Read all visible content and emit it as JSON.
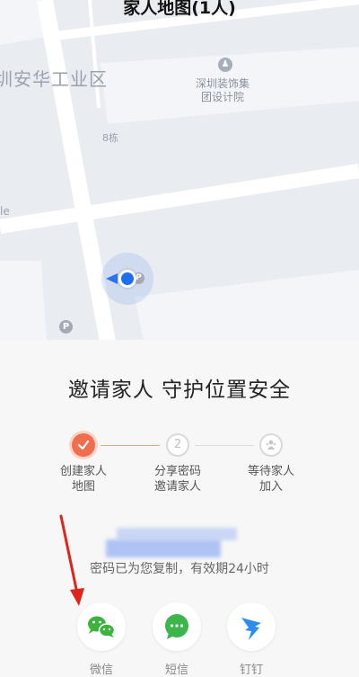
{
  "map": {
    "title": "家人地图(1人)",
    "district_label": "圳安华工业区",
    "poi_label_line1": "深圳装饰集",
    "poi_label_line2": "团设计院",
    "building_label": "8栋",
    "side_label": "le",
    "parking_symbol": "P"
  },
  "invite": {
    "title": "邀请家人 守护位置安全",
    "steps": [
      {
        "number": "",
        "line1": "创建家人",
        "line2": "地图",
        "state": "done"
      },
      {
        "number": "2",
        "line1": "分享密码",
        "line2": "邀请家人",
        "state": "pending"
      },
      {
        "number": "",
        "line1": "等待家人",
        "line2": "加入",
        "state": "pending"
      }
    ],
    "code_hint": "密码已为您复制，有效期24小时"
  },
  "share": {
    "wechat_label": "微信",
    "sms_label": "短信",
    "dingtalk_label": "钉钉"
  },
  "colors": {
    "accent": "#f06e4e",
    "wechat_green": "#3bb33d",
    "sms_green": "#3cb54a",
    "dingtalk_blue": "#2d8cf0",
    "location_blue": "#1f6ff2",
    "annotation_red": "#e0231b"
  }
}
